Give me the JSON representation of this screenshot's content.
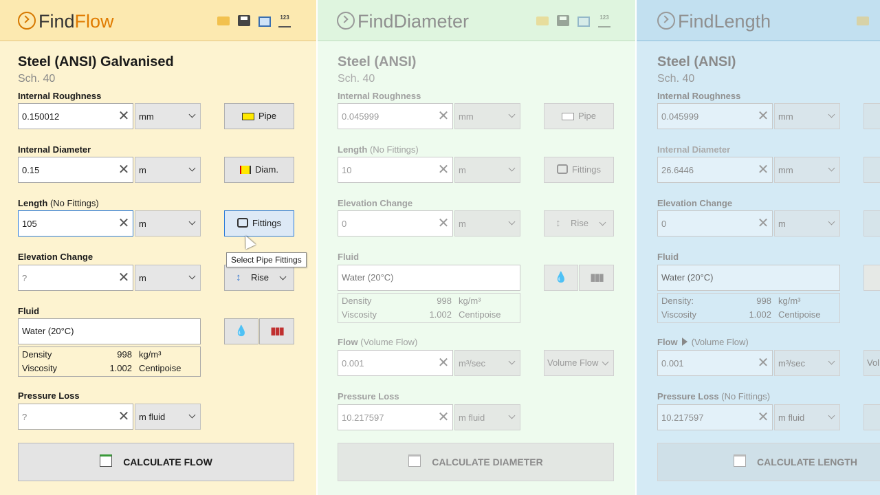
{
  "flow": {
    "logo": {
      "w1": "Find",
      "w2": "Flow"
    },
    "material": "Steel (ANSI) Galvanised",
    "schedule": "Sch.  40",
    "roughness": {
      "label": "Internal Roughness",
      "value": "0.150012",
      "unit": "mm",
      "button": "Pipe"
    },
    "diameter": {
      "label": "Internal Diameter",
      "value": "0.15",
      "unit": "m",
      "button": "Diam."
    },
    "length": {
      "label": "Length",
      "label_sub": "(No Fittings)",
      "value": "105",
      "unit": "m",
      "button": "Fittings"
    },
    "tooltip": "Select Pipe Fittings",
    "elevation": {
      "label": "Elevation Change",
      "value": "?",
      "unit": "m",
      "button": "Rise"
    },
    "fluid": {
      "label": "Fluid",
      "value": "Water (20°C)",
      "density_label": "Density",
      "density_value": "998",
      "density_unit": "kg/m³",
      "viscosity_label": "Viscosity",
      "viscosity_value": "1.002",
      "viscosity_unit": "Centipoise"
    },
    "pressure": {
      "label": "Pressure Loss",
      "value": "?",
      "unit": "m fluid"
    },
    "calculate": "CALCULATE FLOW"
  },
  "diameter_panel": {
    "logo": "FindDiameter",
    "material": "Steel (ANSI)",
    "schedule": "Sch.  40",
    "roughness": {
      "label": "Internal Roughness",
      "value": "0.045999",
      "unit": "mm",
      "button": "Pipe"
    },
    "length": {
      "label": "Length",
      "label_sub": "(No Fittings)",
      "value": "10",
      "unit": "m",
      "button": "Fittings"
    },
    "elevation": {
      "label": "Elevation Change",
      "value": "0",
      "unit": "m",
      "button": "Rise"
    },
    "fluid": {
      "label": "Fluid",
      "value": "Water (20°C)",
      "density_label": "Density",
      "density_value": "998",
      "density_unit": "kg/m³",
      "viscosity_label": "Viscosity",
      "viscosity_value": "1.002",
      "viscosity_unit": "Centipoise"
    },
    "flow": {
      "label": "Flow",
      "label_sub": "(Volume Flow)",
      "value": "0.001",
      "unit": "m³/sec",
      "button": "Volume Flow"
    },
    "pressure": {
      "label": "Pressure Loss",
      "value": "10.217597",
      "unit": "m fluid"
    },
    "calculate": "CALCULATE DIAMETER"
  },
  "length_panel": {
    "logo": "FindLength",
    "material": "Steel (ANSI)",
    "schedule": "Sch.  40",
    "roughness": {
      "label": "Internal Roughness",
      "value": "0.045999",
      "unit": "mm"
    },
    "diameter": {
      "label": "Internal Diameter",
      "value": "26.6446",
      "unit": "mm"
    },
    "elevation": {
      "label": "Elevation Change",
      "value": "0",
      "unit": "m"
    },
    "fluid": {
      "label": "Fluid",
      "value": "Water (20°C)",
      "density_label": "Density:",
      "density_value": "998",
      "density_unit": "kg/m³",
      "viscosity_label": "Viscosity",
      "viscosity_value": "1.002",
      "viscosity_unit": "Centipoise"
    },
    "flow": {
      "label": "Flow",
      "label_sub": "(Volume Flow)",
      "value": "0.001",
      "unit": "m³/sec",
      "button": "Vol"
    },
    "pressure": {
      "label": "Pressure Loss",
      "label_sub": "(No Fittings)",
      "value": "10.217597",
      "unit": "m fluid"
    },
    "calculate": "CALCULATE LENGTH"
  },
  "icons": {
    "toolbar": [
      "folder-icon",
      "save-icon",
      "screen-icon",
      "numbers-icon"
    ]
  },
  "colors": {
    "flow_accent": "#e07b00",
    "focus_border": "#2a7ad8",
    "flow_bg": "#fdf3d0",
    "diameter_bg": "#eefbee",
    "length_bg": "#d4eaf5"
  }
}
